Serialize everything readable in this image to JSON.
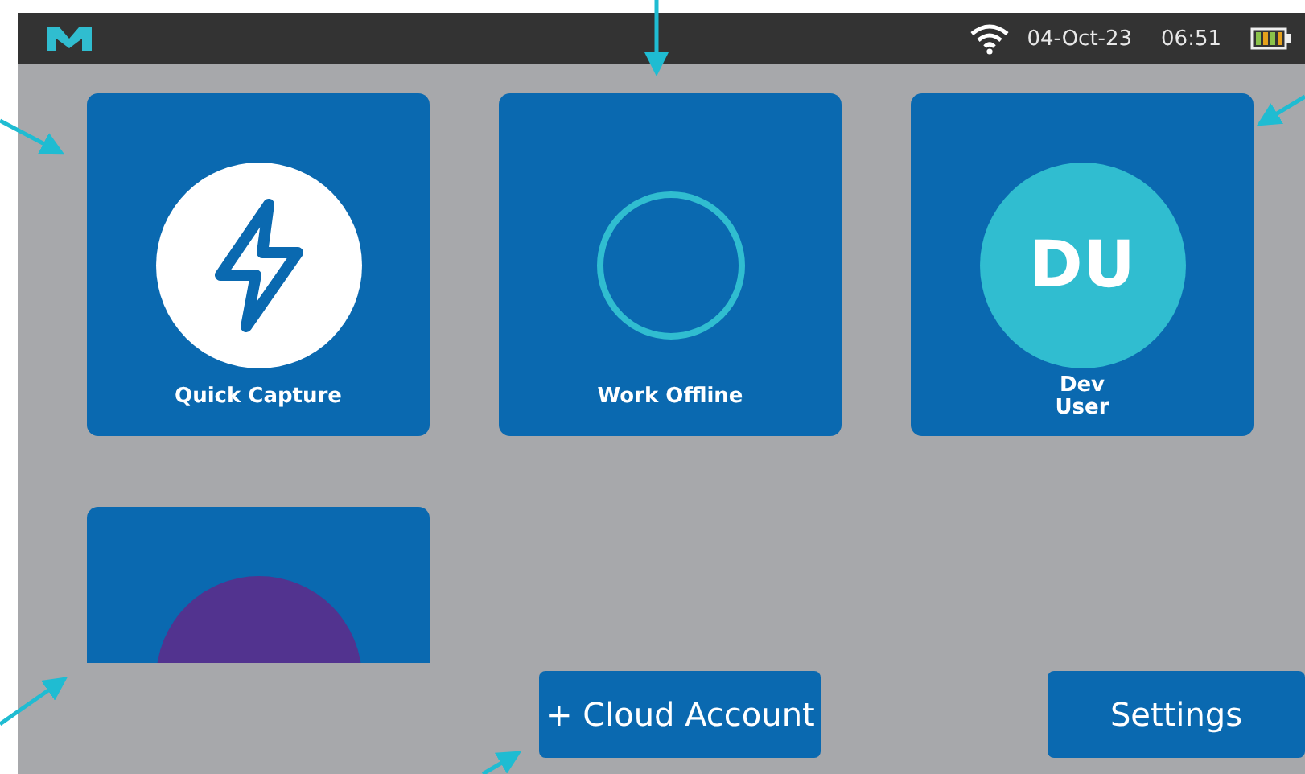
{
  "status_bar": {
    "date": "04-Oct-23",
    "time": "06:51"
  },
  "tiles": [
    {
      "kind": "quick",
      "label": "Quick Capture"
    },
    {
      "kind": "ring",
      "label": "Work Offline"
    },
    {
      "kind": "avatar",
      "label": "Dev\nUser",
      "initials": "DU",
      "color": "#30bdd0"
    },
    {
      "kind": "avatar",
      "color": "#52338f"
    }
  ],
  "buttons": [
    {
      "label": "+ Cloud Account"
    },
    {
      "label": "Settings"
    }
  ]
}
